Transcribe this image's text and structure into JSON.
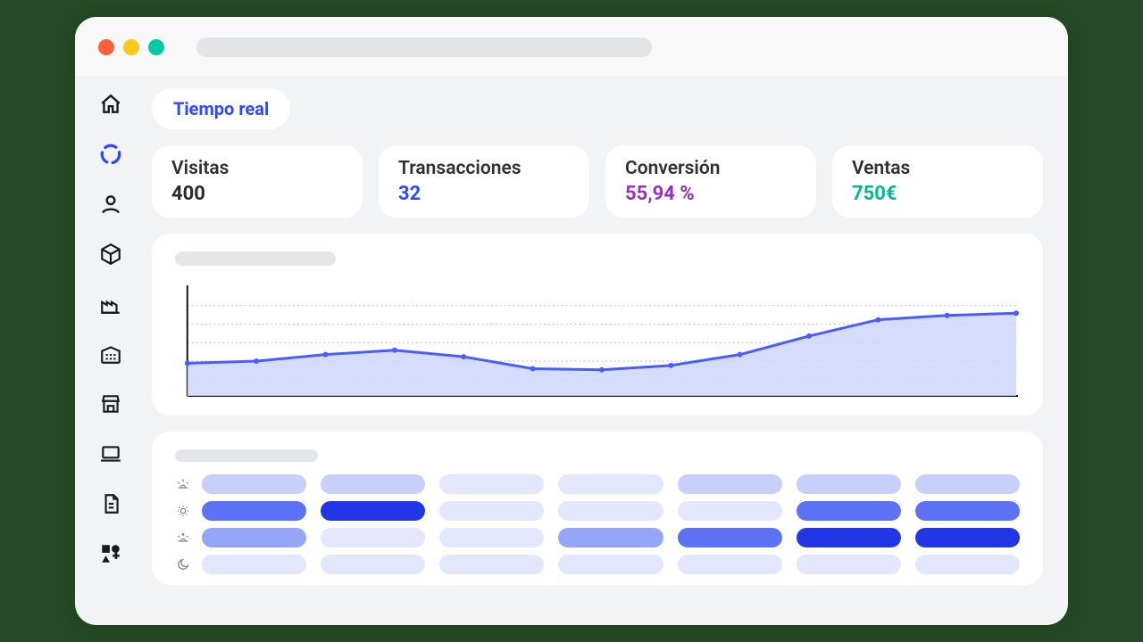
{
  "window": {
    "dots": [
      "#ff5f3c",
      "#ffc81c",
      "#00c9a7"
    ]
  },
  "sidebar": {
    "items": [
      {
        "name": "home-icon",
        "active": false
      },
      {
        "name": "stats-icon",
        "active": true
      },
      {
        "name": "user-icon",
        "active": false
      },
      {
        "name": "package-icon",
        "active": false
      },
      {
        "name": "factory-icon",
        "active": false
      },
      {
        "name": "building-icon",
        "active": false
      },
      {
        "name": "store-icon",
        "active": false
      },
      {
        "name": "laptop-icon",
        "active": false
      },
      {
        "name": "document-icon",
        "active": false
      },
      {
        "name": "shapes-icon",
        "active": false
      }
    ]
  },
  "header": {
    "pill_label": "Tiempo real"
  },
  "metrics": [
    {
      "label": "Visitas",
      "value": "400",
      "color": "#2a2a2a"
    },
    {
      "label": "Transacciones",
      "value": "32",
      "color": "#2c49ff"
    },
    {
      "label": "Conversión",
      "value": "55,94 %",
      "color": "#9b2fbf"
    },
    {
      "label": "Ventas",
      "value": "750€",
      "color": "#00b894"
    }
  ],
  "chart_data": {
    "type": "area",
    "title": "",
    "xlabel": "",
    "ylabel": "",
    "ylim": [
      0,
      100
    ],
    "x": [
      0,
      1,
      2,
      3,
      4,
      5,
      6,
      7,
      8,
      9,
      10,
      11,
      12
    ],
    "values": [
      30,
      32,
      38,
      42,
      36,
      25,
      24,
      28,
      38,
      55,
      70,
      74,
      76
    ],
    "color": "#4a5cff",
    "fill": "#cfd6fb"
  },
  "heatmap": {
    "rows": [
      "sunrise",
      "day",
      "sunset",
      "night"
    ],
    "cols": 7,
    "intensity": [
      [
        0.25,
        0.22,
        0.0,
        0.0,
        0.2,
        0.22,
        0.22
      ],
      [
        0.7,
        0.95,
        0.0,
        0.0,
        0.0,
        0.8,
        0.8
      ],
      [
        0.45,
        0.0,
        0.0,
        0.5,
        0.65,
        0.85,
        1.0
      ],
      [
        0.0,
        0.0,
        0.0,
        0.0,
        0.0,
        0.0,
        0.0
      ]
    ],
    "palette": {
      "empty": "#e3e7fb",
      "low": "#c7d0fb",
      "mid": "#95a6f9",
      "high": "#5d72f5",
      "max": "#2236e6"
    }
  }
}
